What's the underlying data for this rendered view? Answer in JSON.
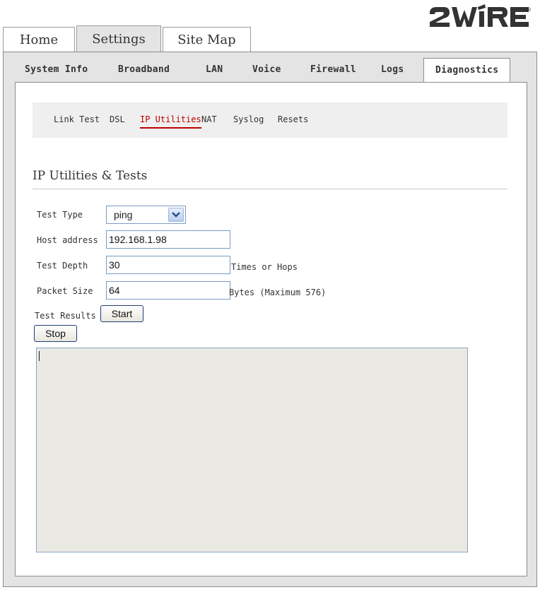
{
  "brand": {
    "logo_text": "2WIRE",
    "trademark": "®"
  },
  "top_tabs": [
    {
      "label": "Home",
      "active": false
    },
    {
      "label": "Settings",
      "active": true
    },
    {
      "label": "Site Map",
      "active": false
    }
  ],
  "sub_tabs": [
    {
      "label": "System Info"
    },
    {
      "label": "Broadband"
    },
    {
      "label": "LAN"
    },
    {
      "label": "Voice"
    },
    {
      "label": "Firewall"
    },
    {
      "label": "Logs"
    },
    {
      "label": "Diagnostics",
      "active": true
    }
  ],
  "links": [
    {
      "label": "Link Test"
    },
    {
      "label": "DSL"
    },
    {
      "label": "IP Utilities",
      "active": true
    },
    {
      "label": "NAT"
    },
    {
      "label": "Syslog"
    },
    {
      "label": "Resets"
    }
  ],
  "section_title": "IP Utilities & Tests",
  "form": {
    "test_type_label": "Test Type",
    "test_type_value": "ping",
    "host_label": "Host address",
    "host_value": "192.168.1.98",
    "depth_label": "Test Depth",
    "depth_value": "30",
    "depth_suffix": "Times or Hops",
    "packet_label": "Packet Size",
    "packet_value": "64",
    "packet_suffix": "Bytes (Maximum 576)",
    "results_label": "Test Results",
    "start_label": "Start",
    "stop_label": "Stop",
    "results_text": ""
  },
  "colors": {
    "accent": "#c00000",
    "panel": "#e4e4e4",
    "results_bg": "#ebe9e3"
  }
}
